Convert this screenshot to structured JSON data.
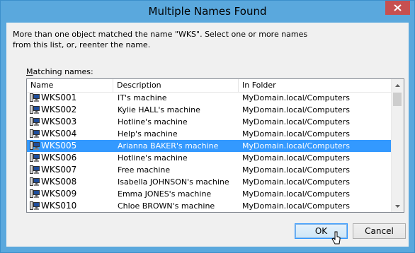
{
  "window": {
    "title": "Multiple Names Found"
  },
  "message": {
    "line1": "More than one object matched the name \"WKS\". Select one or more names",
    "line2": "from this list, or, reenter the name."
  },
  "list": {
    "label_prefix": "M",
    "label_rest": "atching names:",
    "columns": [
      "Name",
      "Description",
      "In Folder"
    ],
    "selected_index": 4,
    "rows": [
      {
        "name": "WKS001",
        "description": "IT's machine",
        "folder": "MyDomain.local/Computers"
      },
      {
        "name": "WKS002",
        "description": "Kylie HALL's machine",
        "folder": "MyDomain.local/Computers"
      },
      {
        "name": "WKS003",
        "description": "Hotline's machine",
        "folder": "MyDomain.local/Computers"
      },
      {
        "name": "WKS004",
        "description": "Help's machine",
        "folder": "MyDomain.local/Computers"
      },
      {
        "name": "WKS005",
        "description": "Arianna BAKER's machine",
        "folder": "MyDomain.local/Computers"
      },
      {
        "name": "WKS006",
        "description": "Hotline's machine",
        "folder": "MyDomain.local/Computers"
      },
      {
        "name": "WKS007",
        "description": "Free machine",
        "folder": "MyDomain.local/Computers"
      },
      {
        "name": "WKS008",
        "description": "Isabella JOHNSON's machine",
        "folder": "MyDomain.local/Computers"
      },
      {
        "name": "WKS009",
        "description": "Emma JONES's machine",
        "folder": "MyDomain.local/Computers"
      },
      {
        "name": "WKS010",
        "description": "Chloe BROWN's machine",
        "folder": "MyDomain.local/Computers"
      }
    ]
  },
  "buttons": {
    "ok": "OK",
    "cancel": "Cancel"
  },
  "colors": {
    "title_bar": "#5aa8dd",
    "close_button": "#c75050",
    "selection": "#3399ff"
  }
}
